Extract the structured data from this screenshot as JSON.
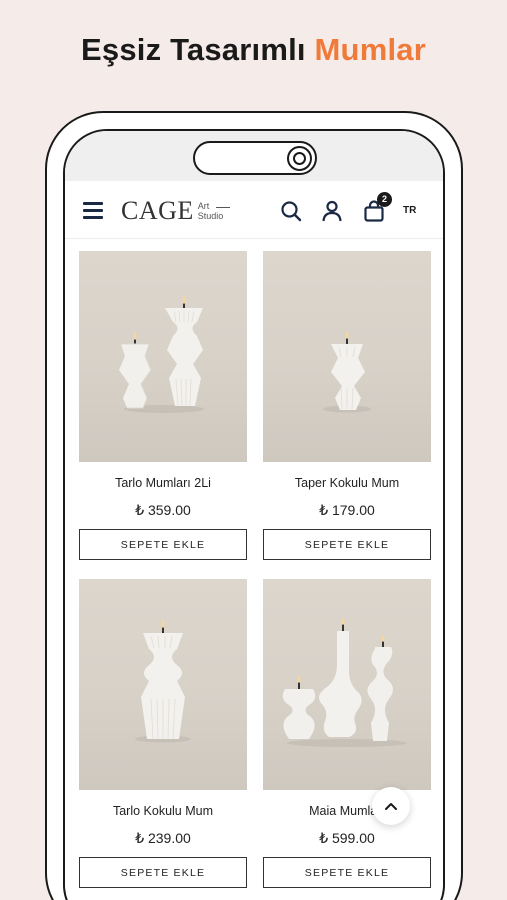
{
  "headline": {
    "text": "Eşsiz Tasarımlı ",
    "accent": "Mumlar",
    "accent_color": "#f07a3a"
  },
  "appbar": {
    "logo_main": "CAGE",
    "logo_sub_1": "Art",
    "logo_sub_2": "Studio",
    "cart_count": "2",
    "language": "TR",
    "icons": [
      "menu-icon",
      "search-icon",
      "user-icon",
      "bag-icon"
    ]
  },
  "products": [
    {
      "name": "Tarlo Mumları 2Li",
      "price": "₺ 359.00",
      "button": "SEPETE EKLE"
    },
    {
      "name": "Taper Kokulu Mum",
      "price": "₺ 179.00",
      "button": "SEPETE EKLE"
    },
    {
      "name": "Tarlo Kokulu Mum",
      "price": "₺ 239.00",
      "button": "SEPETE EKLE"
    },
    {
      "name": "Maia Mumları",
      "price": "₺ 599.00",
      "button": "SEPETE EKLE"
    }
  ],
  "scroll_top_icon": "chevron-up-icon"
}
